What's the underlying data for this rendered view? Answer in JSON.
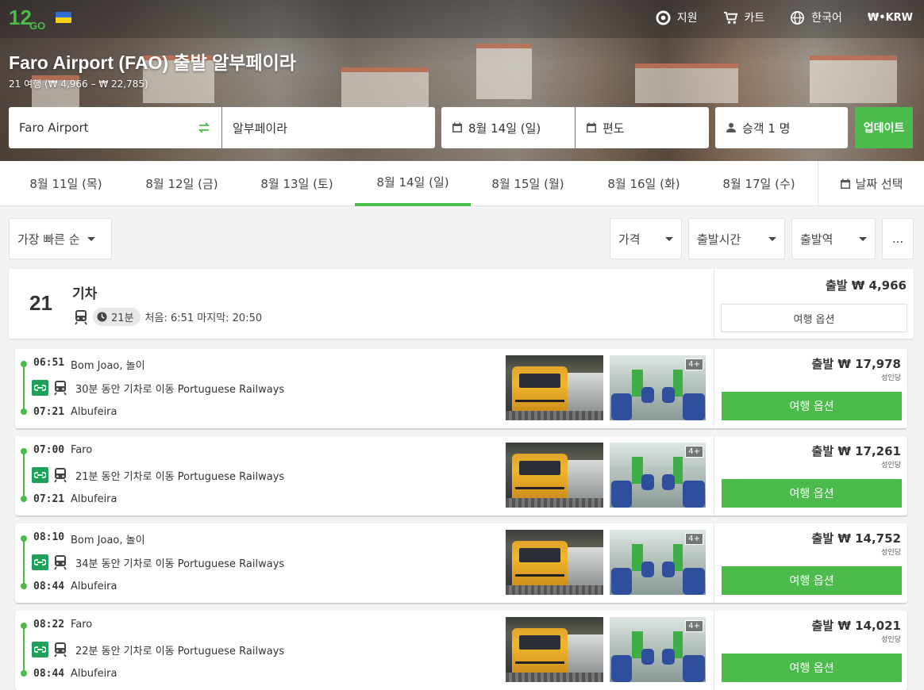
{
  "nav": {
    "support": "지원",
    "cart": "카트",
    "language": "한국어",
    "currency": "₩•KRW"
  },
  "hero": {
    "title": "Faro Airport (FAO) 출발 알부페이라",
    "subtitle": "21 여행 (₩ 4,966 – ₩ 22,785)"
  },
  "search": {
    "from": "Faro Airport",
    "to": "알부페이라",
    "depart_date": "8월 14일 (일)",
    "return_date": "편도",
    "passengers": "승객 1 명",
    "update_label": "업데이트"
  },
  "dates": {
    "tabs": [
      "8월 11일 (목)",
      "8월 12일 (금)",
      "8월 13일 (토)",
      "8월 14일 (일)",
      "8월 15일 (월)",
      "8월 16일 (화)",
      "8월 17일 (수)"
    ],
    "active_index": 3,
    "picker_label": "날짜 선택"
  },
  "filters": {
    "sort": "가장 빠른 순",
    "price": "가격",
    "departure_time": "출발시간",
    "departure_station": "출발역",
    "more": "..."
  },
  "summary": {
    "count": "21",
    "mode": "기차",
    "duration": "21분",
    "first_last": "처음: 6:51 마지막: 20:50",
    "from_price": "출발 ₩ 4,966",
    "options_label": "여행 옵션"
  },
  "trips": [
    {
      "dep_time": "06:51",
      "dep_place": "Bom Joao, 놀이",
      "desc": "30분 동안 기차로 이동 Portuguese Railways",
      "arr_time": "07:21",
      "arr_place": "Albufeira",
      "price": "출발 ₩ 17,978",
      "per": "성인당",
      "button": "여행 옵션",
      "photos_more": "4+"
    },
    {
      "dep_time": "07:00",
      "dep_place": "Faro",
      "desc": "21분 동안 기차로 이동 Portuguese Railways",
      "arr_time": "07:21",
      "arr_place": "Albufeira",
      "price": "출발 ₩ 17,261",
      "per": "성인당",
      "button": "여행 옵션",
      "photos_more": "4+"
    },
    {
      "dep_time": "08:10",
      "dep_place": "Bom Joao, 놀이",
      "desc": "34분 동안 기차로 이동 Portuguese Railways",
      "arr_time": "08:44",
      "arr_place": "Albufeira",
      "price": "출발 ₩ 14,752",
      "per": "성인당",
      "button": "여행 옵션",
      "photos_more": "4+"
    },
    {
      "dep_time": "08:22",
      "dep_place": "Faro",
      "desc": "22분 동안 기차로 이동 Portuguese Railways",
      "arr_time": "08:44",
      "arr_place": "Albufeira",
      "price": "출발 ₩ 14,021",
      "per": "성인당",
      "button": "여행 옵션",
      "photos_more": "4+"
    }
  ],
  "colors": {
    "accent": "#4bbb4b",
    "operator_badge": "#22a05a",
    "flag_blue": "#2f6fd0",
    "flag_yellow": "#f5d117"
  },
  "icons": [
    "logo-12go",
    "ukraine-flag-icon",
    "lifebuoy-icon",
    "cart-icon",
    "globe-icon",
    "swap-icon",
    "calendar-icon",
    "user-icon",
    "caret-down-icon",
    "train-icon",
    "clock-icon",
    "operator-logo-icon"
  ]
}
